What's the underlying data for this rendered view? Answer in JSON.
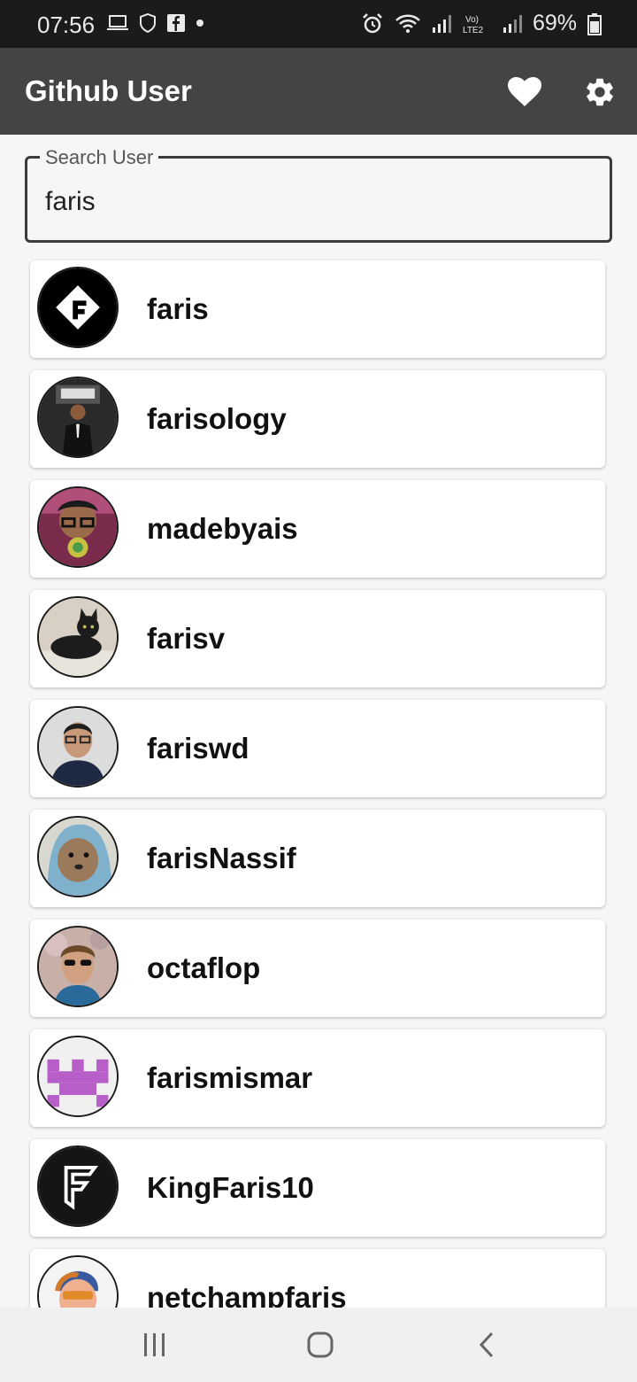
{
  "status_bar": {
    "time": "07:56",
    "battery": "69%"
  },
  "app_bar": {
    "title": "Github User",
    "favorite_icon": "heart-icon",
    "settings_icon": "gear-icon"
  },
  "search": {
    "label": "Search User",
    "value": "faris"
  },
  "users": [
    {
      "login": "faris",
      "avatar": "black-logo-f"
    },
    {
      "login": "farisology",
      "avatar": "man-in-suit-photo"
    },
    {
      "login": "madebyais",
      "avatar": "man-with-glasses-photo"
    },
    {
      "login": "farisv",
      "avatar": "black-cat-photo"
    },
    {
      "login": "fariswd",
      "avatar": "man-portrait-photo"
    },
    {
      "login": "farisNassif",
      "avatar": "dog-in-hoodie-photo"
    },
    {
      "login": "octaflop",
      "avatar": "man-sunglasses-photo"
    },
    {
      "login": "farismismar",
      "avatar": "purple-identicon"
    },
    {
      "login": "KingFaris10",
      "avatar": "black-logo-f"
    },
    {
      "login": "netchampfaris",
      "avatar": "illustrated-avatar"
    }
  ],
  "colors": {
    "app_bar": "#444444",
    "status_bar": "#1b1b1b",
    "background": "#f6f6f6"
  }
}
